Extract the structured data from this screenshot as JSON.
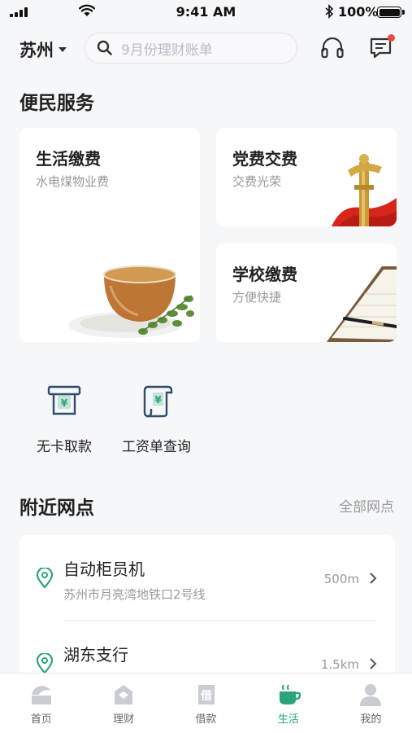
{
  "status_bar": {
    "time": "9:41 AM",
    "battery": "100%"
  },
  "header": {
    "city": "苏州",
    "search_placeholder": "9月份理财账单",
    "has_unread_messages": true
  },
  "convenience": {
    "title": "便民服务",
    "cards": [
      {
        "title": "生活缴费",
        "subtitle": "水电煤物业费",
        "image": "tea-cup"
      },
      {
        "title": "党费交费",
        "subtitle": "交费光荣",
        "image": "huabiao-flag"
      },
      {
        "title": "学校缴费",
        "subtitle": "方便快捷",
        "image": "notebook-pen"
      }
    ],
    "quick_actions": [
      {
        "label": "无卡取款",
        "icon": "atm-yuan-icon"
      },
      {
        "label": "工资单查询",
        "icon": "payslip-scroll-icon"
      }
    ]
  },
  "nearby": {
    "title": "附近网点",
    "all_link": "全部网点",
    "branches": [
      {
        "name": "自动柜员机",
        "address": "苏州市月亮湾地铁口2号线",
        "distance": "500m"
      },
      {
        "name": "湖东支行",
        "address": "",
        "distance": "1.5km"
      }
    ]
  },
  "tabbar": {
    "active": 3,
    "items": [
      {
        "label": "首页",
        "icon": "home-icon"
      },
      {
        "label": "理财",
        "icon": "wealth-icon"
      },
      {
        "label": "借款",
        "icon": "loan-icon"
      },
      {
        "label": "生活",
        "icon": "coffee-cup-icon"
      },
      {
        "label": "我的",
        "icon": "profile-icon"
      }
    ]
  },
  "colors": {
    "accent": "#2aa57a",
    "badge": "#f04a3e",
    "icon_blue": "#2f4b6e"
  }
}
